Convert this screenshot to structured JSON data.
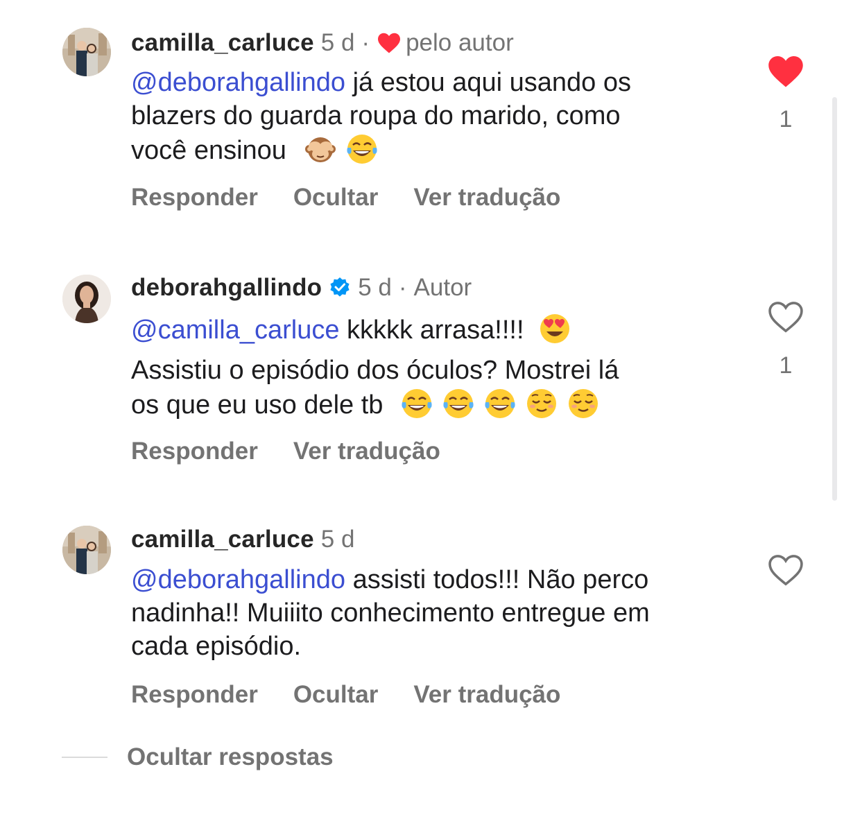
{
  "comments": [
    {
      "username": "camilla_carluce",
      "time": "5 d",
      "separator": "·",
      "badge": "pelo autor",
      "badge_icon": "heart-icon",
      "mention": "@deborahgallindo",
      "lines": [
        "já estou aqui usando os",
        "blazers do guarda roupa do marido, como",
        "você ensinou"
      ],
      "emojis": [
        "see-no-evil-monkey-emoji",
        "tears-of-joy-emoji"
      ],
      "actions": {
        "reply": "Responder",
        "hide": "Ocultar",
        "translate": "Ver tradução"
      },
      "liked": true,
      "likes": "1"
    },
    {
      "username": "deborahgallindo",
      "verified": true,
      "time": "5 d",
      "separator": "·",
      "badge": "Autor",
      "mention": "@camilla_carluce",
      "lines": [
        "kkkkk arrasa!!!!",
        "Assistiu o episódio dos óculos? Mostrei lá",
        "os que eu uso dele tb"
      ],
      "emojis": [
        "heart-eyes-emoji",
        "tears-of-joy-emoji",
        "tears-of-joy-emoji",
        "tears-of-joy-emoji",
        "relieved-face-emoji",
        "relieved-face-emoji"
      ],
      "actions": {
        "reply": "Responder",
        "translate": "Ver tradução"
      },
      "liked": false,
      "likes": "1"
    },
    {
      "username": "camilla_carluce",
      "time": "5 d",
      "mention": "@deborahgallindo",
      "lines": [
        "assisti todos!!! Não perco",
        "nadinha!! Muiiito conhecimento entregue em",
        "cada episódio."
      ],
      "actions": {
        "reply": "Responder",
        "hide": "Ocultar",
        "translate": "Ver tradução"
      },
      "liked": false
    }
  ],
  "hide_replies": "Ocultar respostas",
  "colors": {
    "mention": "#3b4ed1",
    "muted": "#737373",
    "like_red": "#ff3040",
    "verified_blue": "#0095f6"
  }
}
